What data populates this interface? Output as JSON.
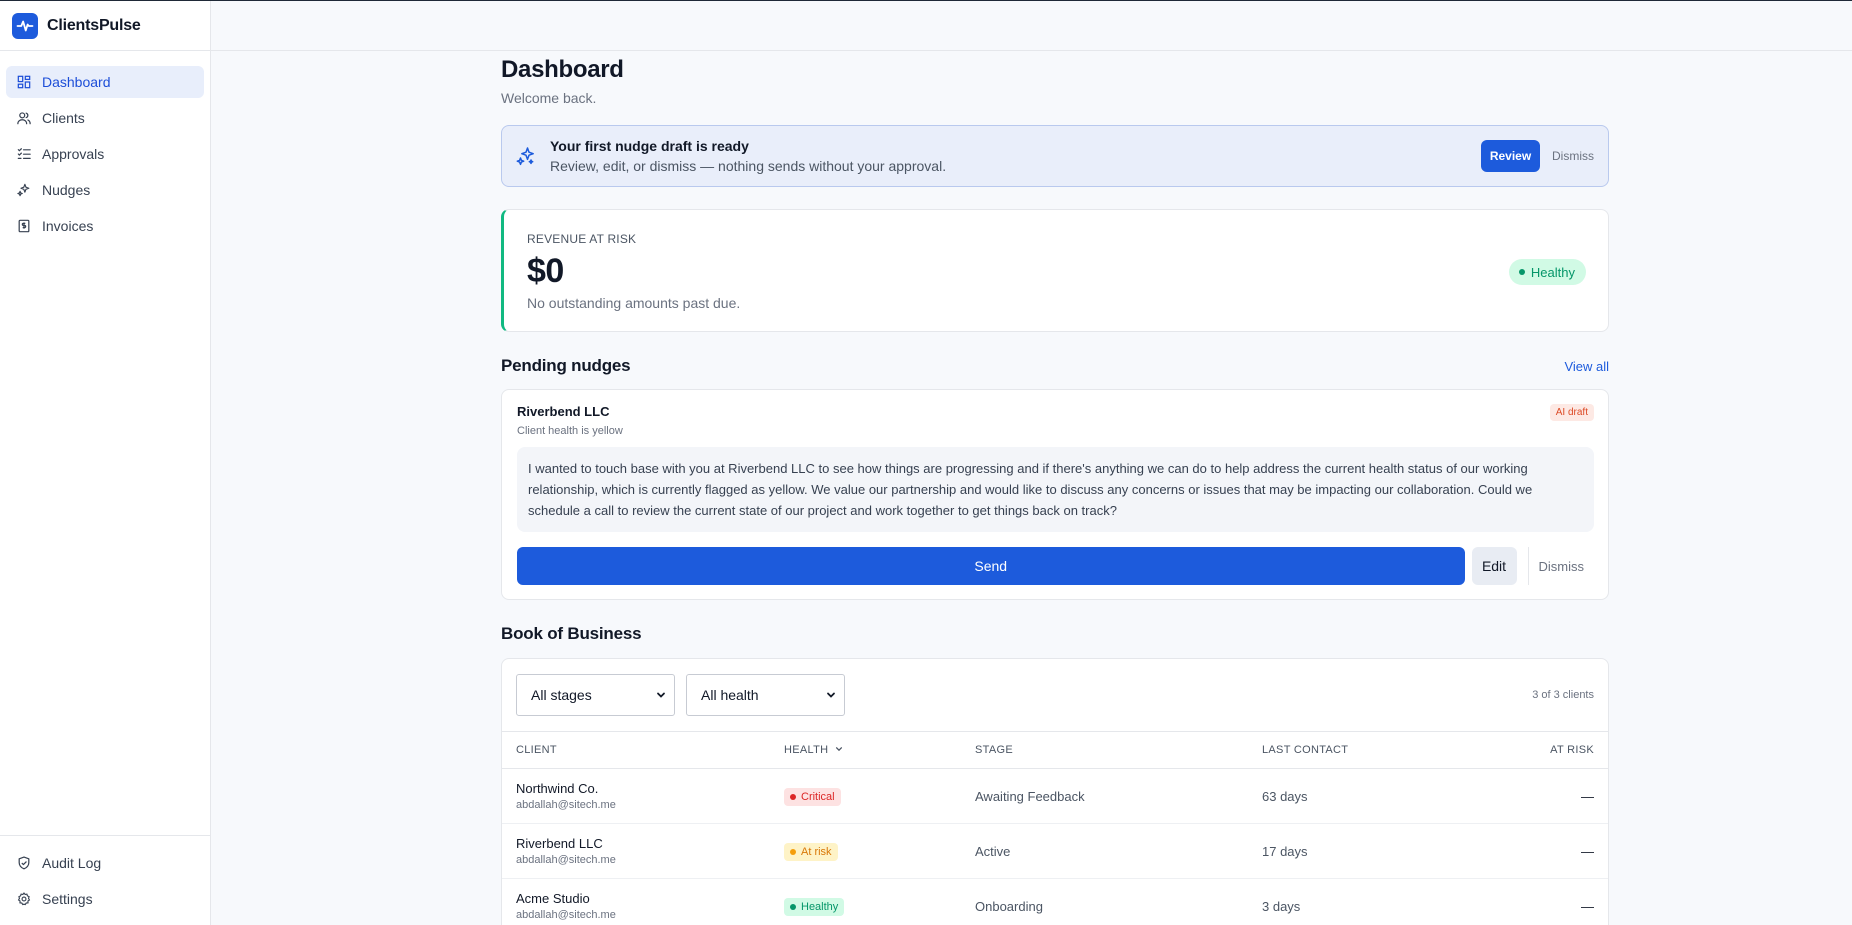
{
  "app": {
    "name": "ClientsPulse"
  },
  "sidebar": {
    "items": [
      {
        "label": "Dashboard",
        "icon": "grid-icon",
        "active": true
      },
      {
        "label": "Clients",
        "icon": "users-icon"
      },
      {
        "label": "Approvals",
        "icon": "list-check-icon"
      },
      {
        "label": "Nudges",
        "icon": "sparkles-icon"
      },
      {
        "label": "Invoices",
        "icon": "invoice-icon"
      }
    ],
    "bottom": [
      {
        "label": "Audit Log",
        "icon": "shield-icon"
      },
      {
        "label": "Settings",
        "icon": "gear-icon"
      }
    ]
  },
  "page": {
    "title": "Dashboard",
    "subtitle": "Welcome back."
  },
  "banner": {
    "title": "Your first nudge draft is ready",
    "description": "Review, edit, or dismiss — nothing sends without your approval.",
    "review_label": "Review",
    "dismiss_label": "Dismiss"
  },
  "revenue": {
    "label": "REVENUE AT RISK",
    "value": "$0",
    "description": "No outstanding amounts past due.",
    "status": "Healthy"
  },
  "nudges": {
    "title": "Pending nudges",
    "view_all": "View all",
    "item": {
      "client": "Riverbend LLC",
      "subtitle": "Client health is yellow",
      "badge": "AI draft",
      "body": "I wanted to touch base with you at Riverbend LLC to see how things are progressing and if there's anything we can do to help address the current health status of our working relationship, which is currently flagged as yellow. We value our partnership and would like to discuss any concerns or issues that may be impacting our collaboration. Could we schedule a call to review the current state of our project and work together to get things back on track?",
      "send_label": "Send",
      "edit_label": "Edit",
      "dismiss_label": "Dismiss"
    }
  },
  "book": {
    "title": "Book of Business",
    "filters": {
      "stage": "All stages",
      "health": "All health"
    },
    "count": "3 of 3 clients",
    "columns": {
      "client": "CLIENT",
      "health": "HEALTH",
      "stage": "STAGE",
      "last_contact": "LAST CONTACT",
      "at_risk": "AT RISK"
    },
    "rows": [
      {
        "name": "Northwind Co.",
        "email": "abdallah@sitech.me",
        "health": "Critical",
        "stage": "Awaiting Feedback",
        "last_contact": "63 days",
        "at_risk": "—"
      },
      {
        "name": "Riverbend LLC",
        "email": "abdallah@sitech.me",
        "health": "At risk",
        "stage": "Active",
        "last_contact": "17 days",
        "at_risk": "—"
      },
      {
        "name": "Acme Studio",
        "email": "abdallah@sitech.me",
        "health": "Healthy",
        "stage": "Onboarding",
        "last_contact": "3 days",
        "at_risk": "—"
      }
    ]
  },
  "colors": {
    "accent": "#1d5bdc",
    "critical_bg": "#fde2e2",
    "critical_fg": "#dc2626",
    "atrisk_bg": "#fef3c7",
    "atrisk_fg": "#d97706",
    "healthy_bg": "#d1fae5",
    "healthy_fg": "#059669"
  }
}
